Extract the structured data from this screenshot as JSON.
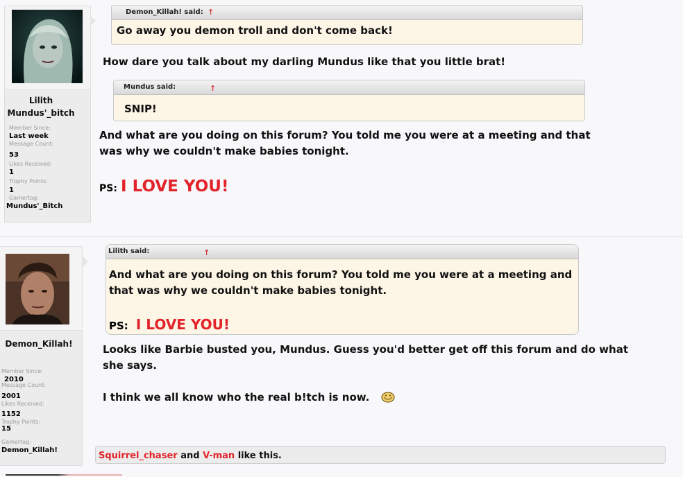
{
  "post1": {
    "username": "Lilith",
    "title": "Mundus'_bitch",
    "extra": [
      {
        "label": "Member Since:",
        "value": "Last week"
      },
      {
        "label": "Message Count:",
        "value": "53"
      },
      {
        "label": "Likes Received:",
        "value": "1"
      },
      {
        "label": "Trophy Points:",
        "value": "1"
      },
      {
        "label": "Gamertag:",
        "value": "Mundus'_Bitch"
      }
    ],
    "quote1": {
      "author": "Demon_Killah! said:",
      "text": "Go away you demon troll and don't come back!"
    },
    "reply1": "How dare you talk about my darling Mundus like that you little brat!",
    "quote2": {
      "author": "Mundus said:",
      "text": "SNIP!"
    },
    "reply2": "And what are you doing on this forum? You told me you were at a meeting and that was why we couldn't make babies tonight.",
    "ps_label": "PS:",
    "ps_text": "I LOVE YOU!"
  },
  "post2": {
    "username": "Demon_Killah!",
    "extra": [
      {
        "label": "Member Since:",
        "value": "2010"
      },
      {
        "label": "Message Count:",
        "value": "2001"
      },
      {
        "label": "Likes Received:",
        "value": "1152"
      },
      {
        "label": "Trophy Points:",
        "value": "15"
      },
      {
        "label": "Gamertag:",
        "value": "Demon_Killah!"
      }
    ],
    "quote": {
      "author": "Lilith said:",
      "text": "And what are you doing on this forum? You told me you were at a meeting and that was why we couldn't make babies tonight.",
      "ps_label": "PS:",
      "ps_text": "I LOVE YOU!"
    },
    "reply1": "Looks like Barbie busted you, Mundus. Guess you'd better get off this forum and do what she says.",
    "reply2": "I think we all know who the real b!tch is now.",
    "likes": {
      "user1": "Squirrel_chaser",
      "conj": "and",
      "user2": "V-man",
      "suffix": "like this."
    }
  },
  "colors": {
    "accent_red": "#e2232a",
    "quote_bg": "#fdf5e6",
    "page_bg": "#f8f8fb"
  }
}
